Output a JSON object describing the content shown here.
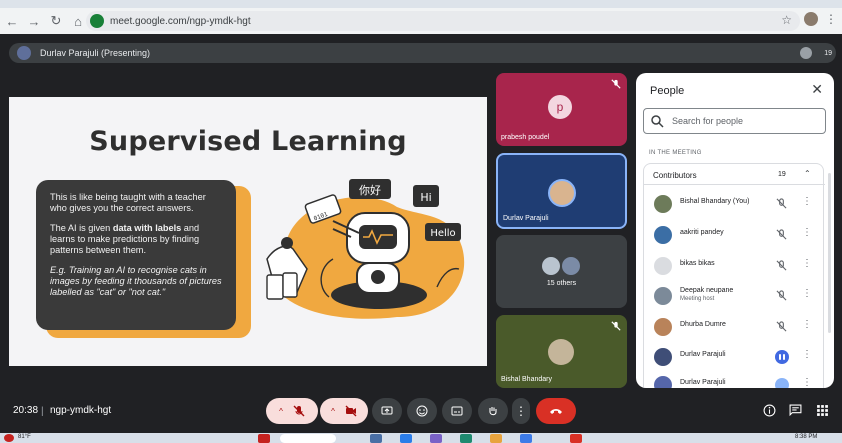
{
  "browser": {
    "url": "meet.google.com/ngp-ymdk-hgt"
  },
  "header": {
    "presenting_text": "Durlav Parajuli (Presenting)",
    "people_count": "19"
  },
  "slide": {
    "title": "Supervised Learning",
    "para1": "This is like being taught with a teacher who gives you the correct answers.",
    "para2_pre": "The AI is given ",
    "para2_bold": "data with labels",
    "para2_post": " and learns to make predictions by finding patterns between them.",
    "para3": "E.g. Training an AI to recognise cats in images by feeding it thousands of pictures labelled as \"cat\" or \"not cat.\"",
    "bubble1": "你好",
    "bubble2": "Hi",
    "bubble3": "Hello",
    "binary": "0101"
  },
  "tiles": [
    {
      "name": "prabesh poudel",
      "initial": "p",
      "bg": "#a8254c"
    },
    {
      "name": "Durlav Parajuli",
      "bg": "#1f3d73"
    },
    {
      "name": "15 others",
      "bg": "#3c4043"
    },
    {
      "name": "Bishal Bhandary",
      "bg": "#4a5a2a"
    }
  ],
  "people_panel": {
    "title": "People",
    "search_placeholder": "Search for people",
    "section_label": "IN THE MEETING",
    "group_label": "Contributors",
    "group_count": "19",
    "members": [
      {
        "name": "Bishal Bhandary (You)",
        "role": "",
        "avatar_color": "#6d7b5a"
      },
      {
        "name": "aakriti pandey",
        "role": "",
        "avatar_color": "#3b6ea5"
      },
      {
        "name": "bikas bikas",
        "role": "",
        "avatar_color": "#dadce0"
      },
      {
        "name": "Deepak neupane",
        "role": "Meeting host",
        "avatar_color": "#7c8a99"
      },
      {
        "name": "Dhurba Dumre",
        "role": "",
        "avatar_color": "#b9835a"
      },
      {
        "name": "Durlav Parajuli",
        "role": "",
        "avatar_color": "#3f4e77"
      },
      {
        "name": "Durlav Parajuli",
        "role": "",
        "avatar_color": "#5566aa"
      }
    ]
  },
  "controls": {
    "time": "20:38",
    "separator": "|",
    "meeting_code": "ngp-ymdk-hgt"
  },
  "taskbar": {
    "weather": "81°F",
    "time": "8:38 PM"
  },
  "colors": {
    "accent_orange": "#f0a840",
    "end_call_red": "#d93025",
    "muted_pink": "#f9dedc",
    "speaking_blue": "#4169e1"
  }
}
